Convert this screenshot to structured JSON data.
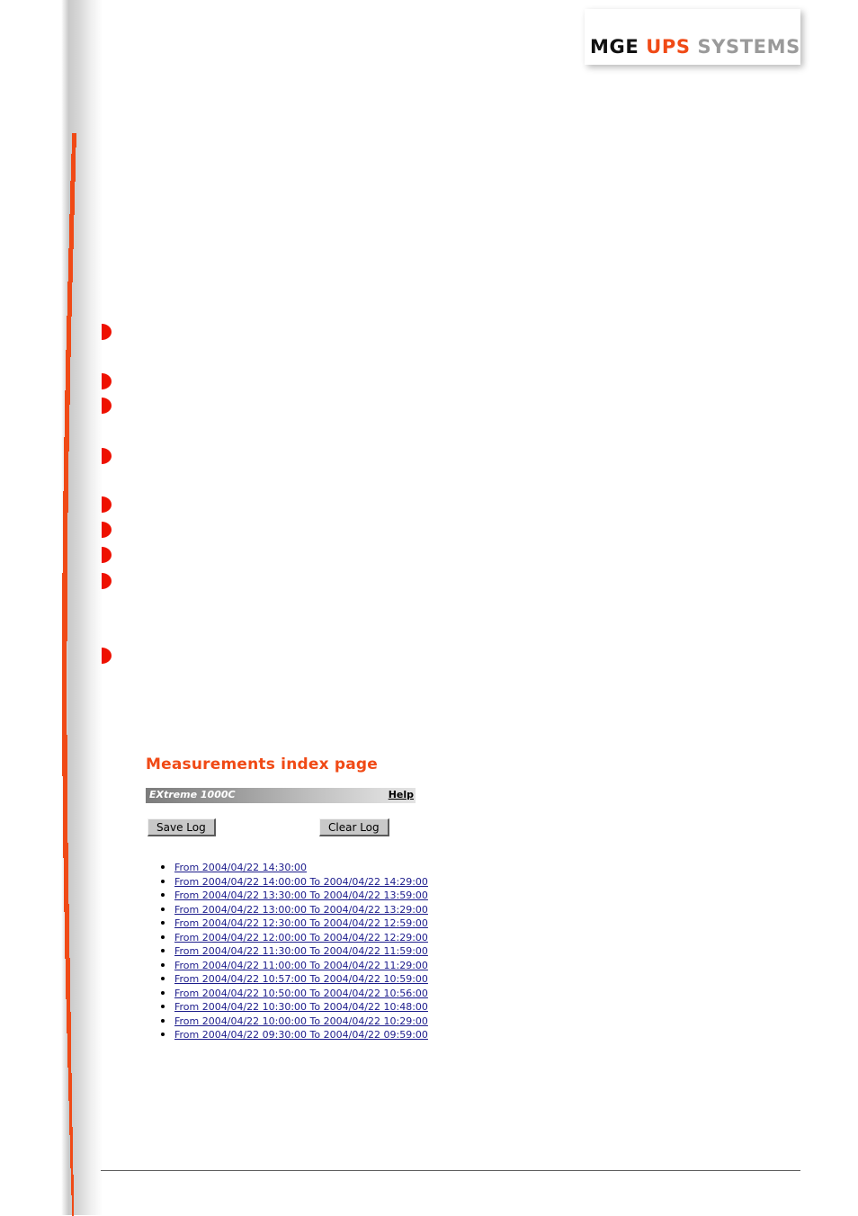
{
  "logo": {
    "part1": "MGE",
    "part2": "UPS",
    "part3": "SYSTEMS",
    "color_accent": "#F04A16",
    "color_dark": "#111111",
    "color_grey": "#9a9a9a"
  },
  "page": {
    "heading": "Measurements index page",
    "heading_color": "#F04A16"
  },
  "device_bar": {
    "device_name": "EXtreme 1000C",
    "help_label": "Help"
  },
  "toolbar": {
    "save_label": "Save Log",
    "clear_label": "Clear Log"
  },
  "log_entries": [
    {
      "label": "From 2004/04/22 14:30:00"
    },
    {
      "label": "From 2004/04/22 14:00:00 To 2004/04/22 14:29:00"
    },
    {
      "label": "From 2004/04/22 13:30:00 To 2004/04/22 13:59:00"
    },
    {
      "label": "From 2004/04/22 13:00:00 To 2004/04/22 13:29:00"
    },
    {
      "label": "From 2004/04/22 12:30:00 To 2004/04/22 12:59:00"
    },
    {
      "label": "From 2004/04/22 12:00:00 To 2004/04/22 12:29:00"
    },
    {
      "label": "From 2004/04/22 11:30:00 To 2004/04/22 11:59:00"
    },
    {
      "label": "From 2004/04/22 11:00:00 To 2004/04/22 11:29:00"
    },
    {
      "label": "From 2004/04/22 10:57:00 To 2004/04/22 10:59:00"
    },
    {
      "label": "From 2004/04/22 10:50:00 To 2004/04/22 10:56:00"
    },
    {
      "label": "From 2004/04/22 10:30:00 To 2004/04/22 10:48:00"
    },
    {
      "label": "From 2004/04/22 10:00:00 To 2004/04/22 10:29:00"
    },
    {
      "label": "From 2004/04/22 09:30:00 To 2004/04/22 09:59:00"
    }
  ],
  "margin_bullets": {
    "color": "#EE1100",
    "positions_y": [
      360,
      415,
      442,
      498,
      552,
      580,
      608,
      637,
      720
    ]
  }
}
